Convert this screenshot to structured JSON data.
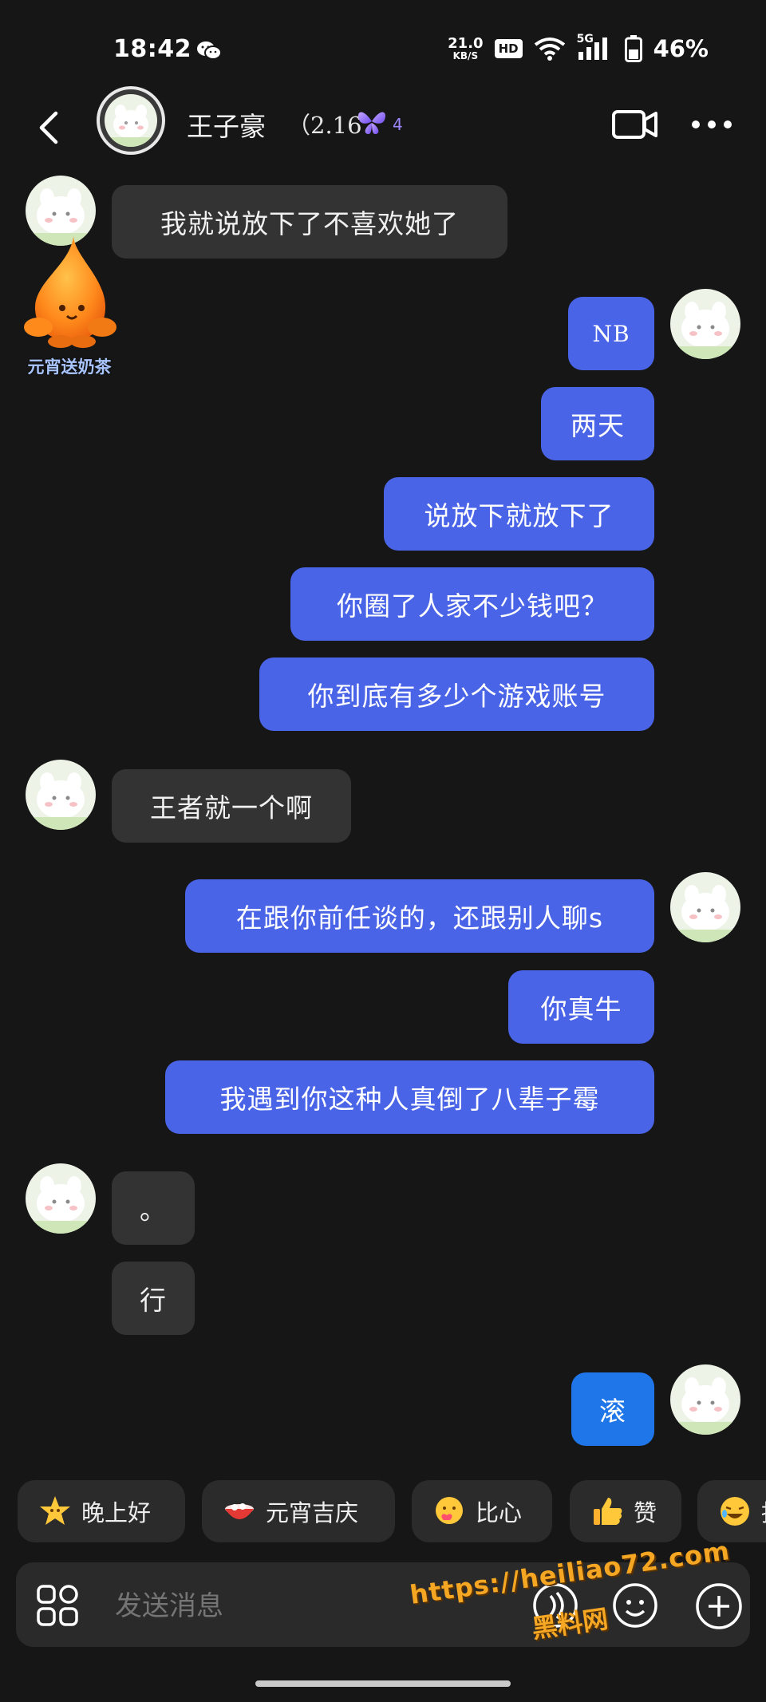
{
  "status_bar": {
    "time": "18:42",
    "net_speed_value": "21.0",
    "net_speed_unit": "KB/S",
    "hd_label": "HD",
    "signal_label": "5G",
    "battery": "46%"
  },
  "header": {
    "contact_name": "王子豪",
    "contact_extra": "（2.16",
    "level": "4"
  },
  "messages": [
    {
      "side": "in",
      "text": "我就说放下了不喜欢她了"
    },
    {
      "side": "out",
      "text": "NB"
    },
    {
      "side": "out",
      "text": "两天"
    },
    {
      "side": "out",
      "text": "说放下就放下了"
    },
    {
      "side": "out",
      "text": "你圈了人家不少钱吧？"
    },
    {
      "side": "out",
      "text": "你到底有多少个游戏账号"
    },
    {
      "side": "in",
      "text": "王者就一个啊"
    },
    {
      "side": "out",
      "text": "在跟你前任谈的，还跟别人聊s"
    },
    {
      "side": "out",
      "text": "你真牛"
    },
    {
      "side": "out",
      "text": "我遇到你这种人真倒了八辈子霉"
    },
    {
      "side": "in",
      "text": "。"
    },
    {
      "side": "in",
      "text": "行"
    },
    {
      "side": "out",
      "text": "滚"
    }
  ],
  "gift": {
    "label": "元宵送奶茶"
  },
  "quick_replies": [
    {
      "label": "晚上好",
      "icon": "star-face-icon"
    },
    {
      "label": "元宵吉庆",
      "icon": "bowl-icon"
    },
    {
      "label": "比心",
      "icon": "heart-hands-icon"
    },
    {
      "label": "赞",
      "icon": "thumbs-up-icon"
    },
    {
      "label": "抱",
      "icon": "laughing-face-icon"
    }
  ],
  "input": {
    "placeholder": "发送消息"
  },
  "watermark": {
    "url": "https://heiliao72.com",
    "name": "黑料网"
  },
  "colors": {
    "background": "#161616",
    "incoming_bubble": "#333333",
    "outgoing_bubble": "#4a64e8",
    "outgoing_last": "#1f76e8"
  }
}
